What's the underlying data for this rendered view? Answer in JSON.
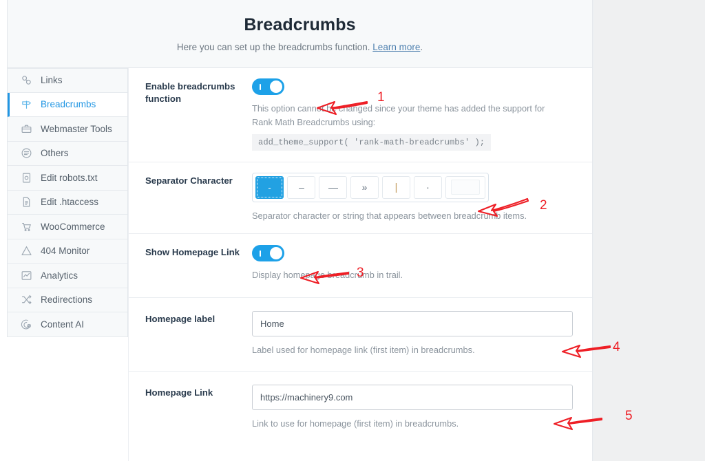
{
  "header": {
    "title": "Breadcrumbs",
    "subtitle_before": "Here you can set up the breadcrumbs function. ",
    "subtitle_link": "Learn more",
    "subtitle_after": "."
  },
  "sidebar": {
    "items": [
      {
        "label": "Links",
        "icon": "link-icon",
        "active": false
      },
      {
        "label": "Breadcrumbs",
        "icon": "signpost-icon",
        "active": true
      },
      {
        "label": "Webmaster Tools",
        "icon": "toolbox-icon",
        "active": false
      },
      {
        "label": "Others",
        "icon": "list-circle-icon",
        "active": false
      },
      {
        "label": "Edit robots.txt",
        "icon": "robots-file-icon",
        "active": false
      },
      {
        "label": "Edit .htaccess",
        "icon": "document-icon",
        "active": false
      },
      {
        "label": "WooCommerce",
        "icon": "cart-icon",
        "active": false
      },
      {
        "label": "404 Monitor",
        "icon": "warning-triangle-icon",
        "active": false
      },
      {
        "label": "Analytics",
        "icon": "chart-icon",
        "active": false
      },
      {
        "label": "Redirections",
        "icon": "shuffle-icon",
        "active": false
      },
      {
        "label": "Content AI",
        "icon": "content-ai-icon",
        "active": false
      }
    ]
  },
  "settings": {
    "enable_breadcrumbs": {
      "label": "Enable breadcrumbs function",
      "toggle_state": "on",
      "help_line_1": "This option cannot be changed since your theme has added the support for Rank Math Breadcrumbs using:",
      "code": "add_theme_support( 'rank-math-breadcrumbs' );"
    },
    "separator_character": {
      "label": "Separator Character",
      "options": [
        "-",
        "–",
        "—",
        "»",
        "|",
        "·"
      ],
      "selected_index": 0,
      "custom_value": "",
      "help": "Separator character or string that appears between breadcrumb items."
    },
    "show_homepage_link": {
      "label": "Show Homepage Link",
      "toggle_state": "on",
      "help": "Display homepage breadcrumb in trail."
    },
    "homepage_label": {
      "label": "Homepage label",
      "value": "Home",
      "help": "Label used for homepage link (first item) in breadcrumbs."
    },
    "homepage_link": {
      "label": "Homepage Link",
      "value": "https://machinery9.com",
      "help": "Link to use for homepage (first item) in breadcrumbs."
    }
  },
  "annotations": {
    "color": "#ee1f26",
    "markers": [
      {
        "number": "1",
        "points_to": "enable-breadcrumbs-toggle"
      },
      {
        "number": "2",
        "points_to": "separator-character-group"
      },
      {
        "number": "3",
        "points_to": "show-homepage-link-toggle"
      },
      {
        "number": "4",
        "points_to": "homepage-label-input"
      },
      {
        "number": "5",
        "points_to": "homepage-link-input"
      }
    ]
  }
}
